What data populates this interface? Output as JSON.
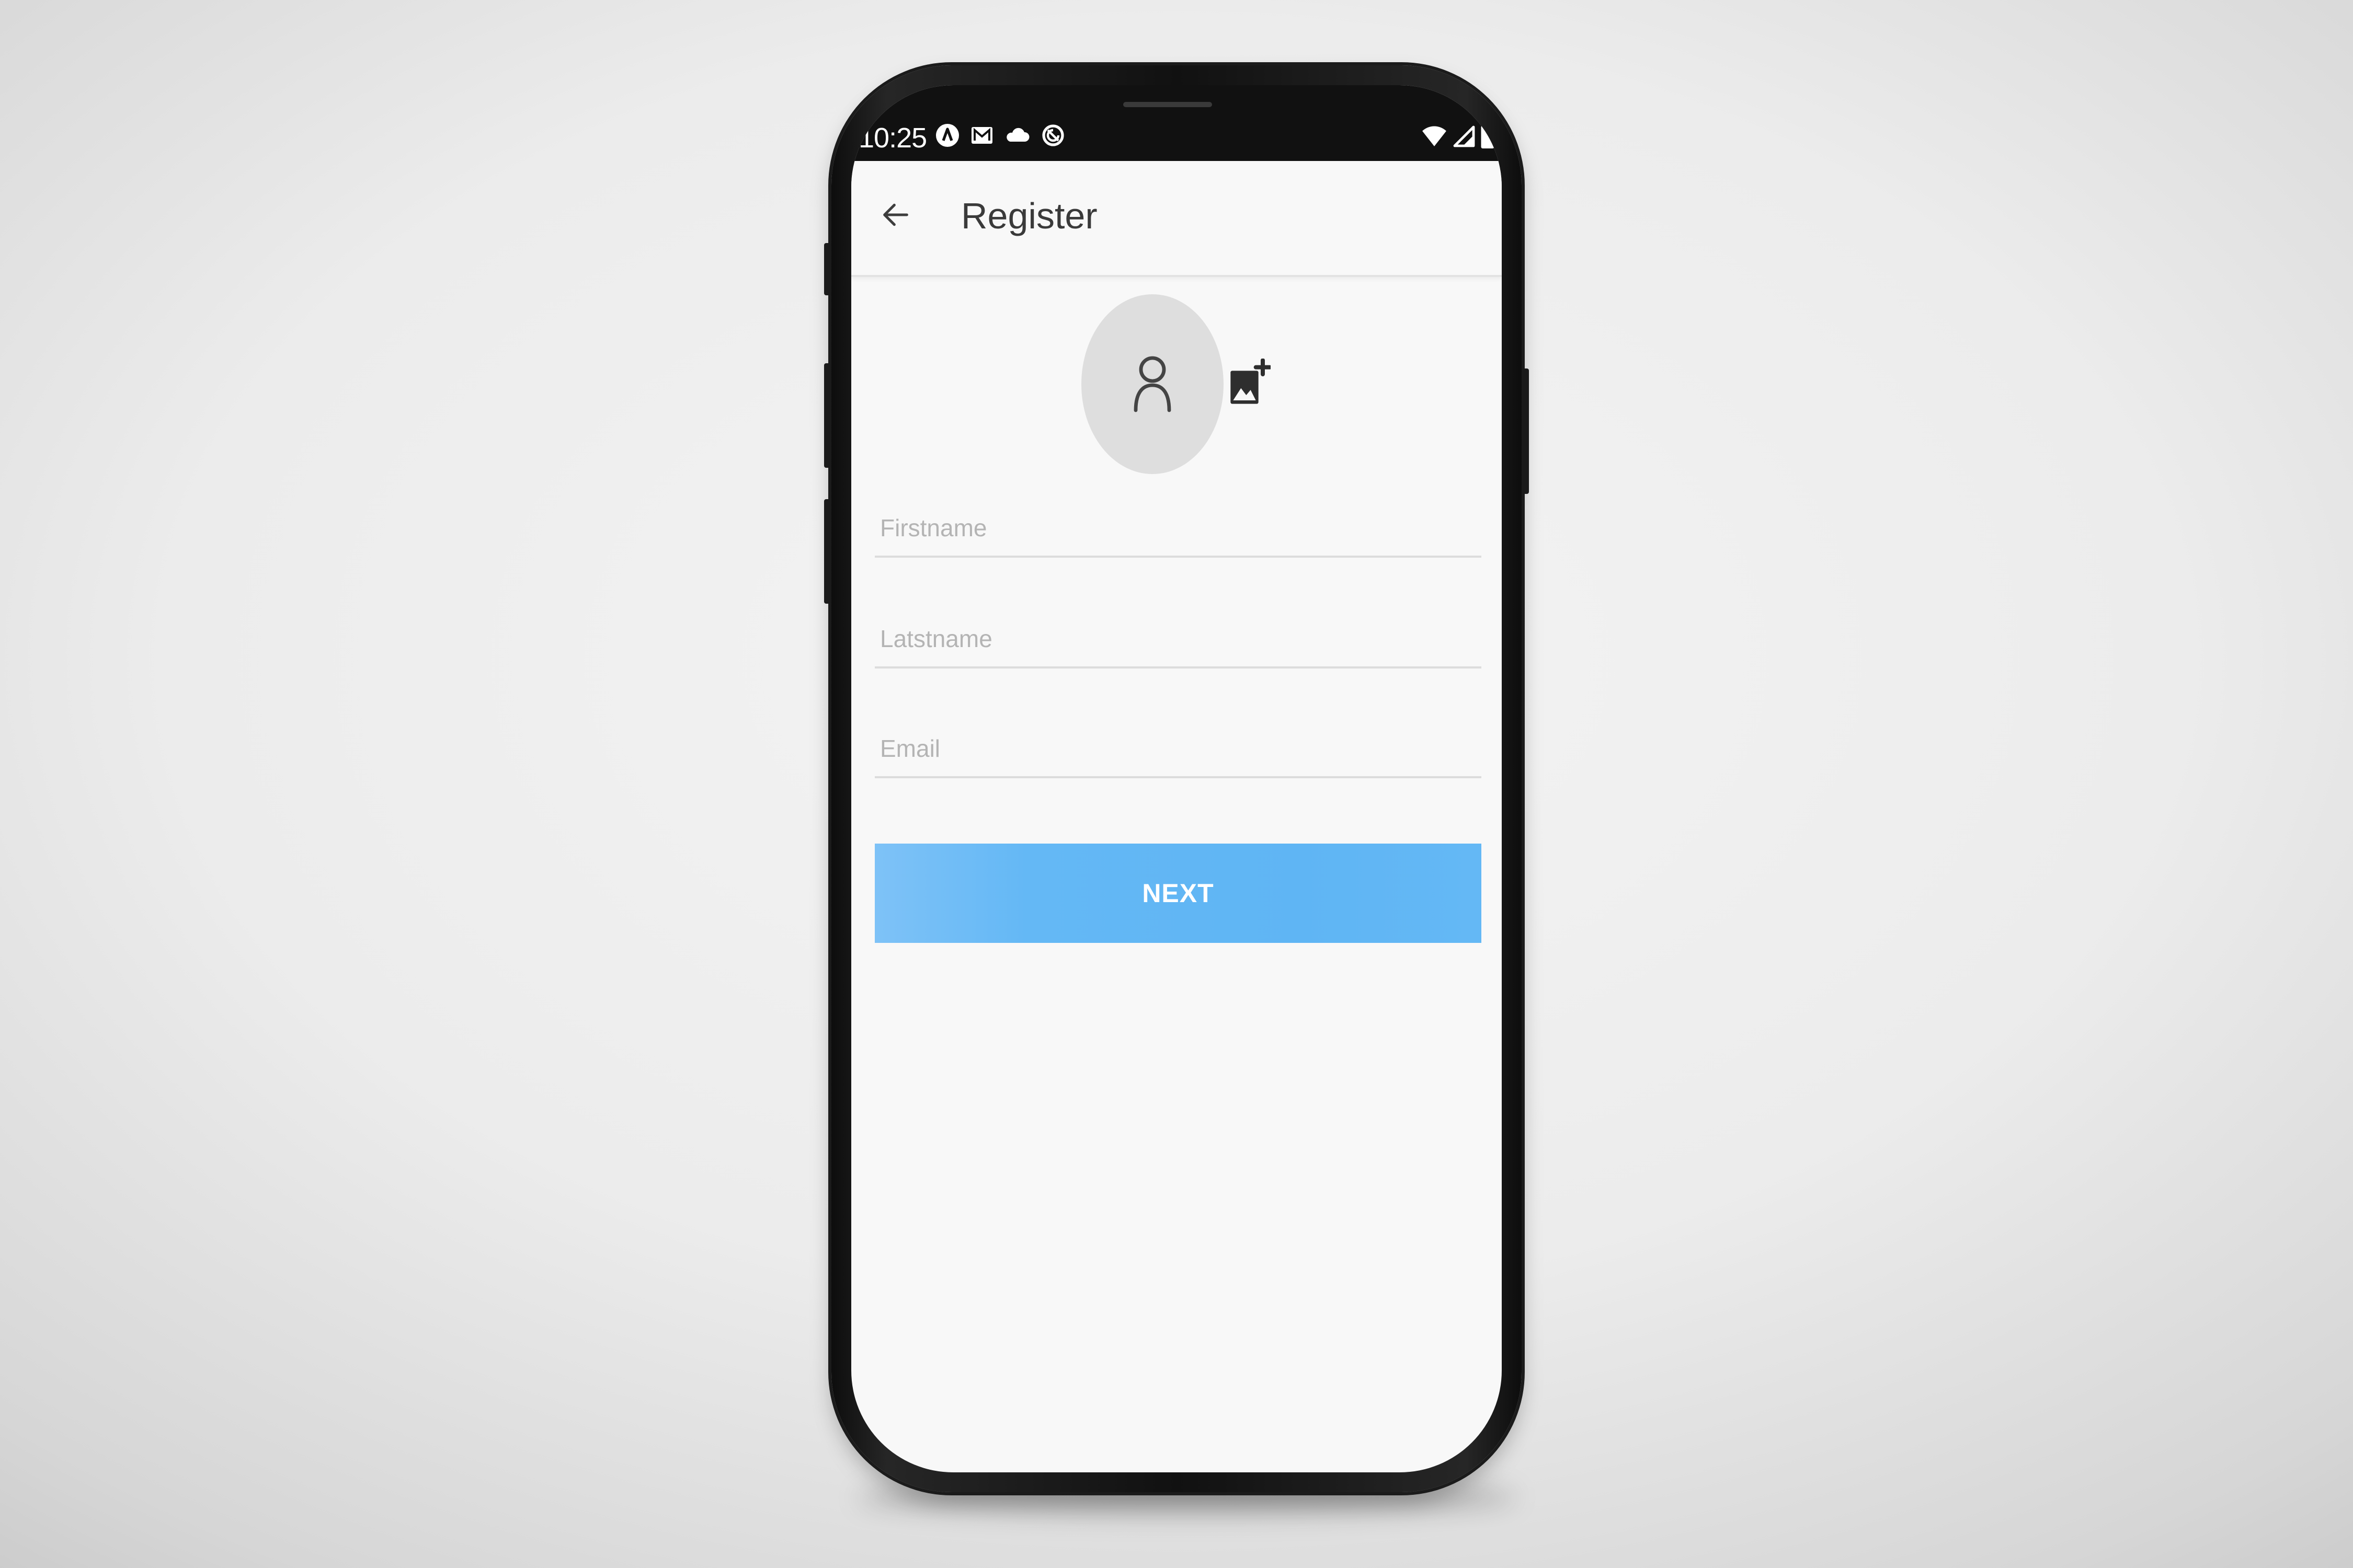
{
  "status_bar": {
    "time": "10:25",
    "left_icons": [
      "app-notification-icon",
      "mail-icon",
      "cloud-icon",
      "sync-icon"
    ],
    "right_icons": [
      "wifi-icon",
      "signal-icon",
      "battery-icon"
    ]
  },
  "app_bar": {
    "back_icon": "arrow-back-icon",
    "title": "Register"
  },
  "form": {
    "avatar_icon": "person-icon",
    "add_photo_icon": "add-photo-icon",
    "firstname_placeholder": "Firstname",
    "lastname_placeholder": "Latstname",
    "email_placeholder": "Email",
    "next_label": "NEXT"
  },
  "colors": {
    "accent": "#5fb5f4",
    "status_bar": "#111111",
    "screen_background": "#f8f8f8",
    "avatar_background": "#dedede"
  }
}
